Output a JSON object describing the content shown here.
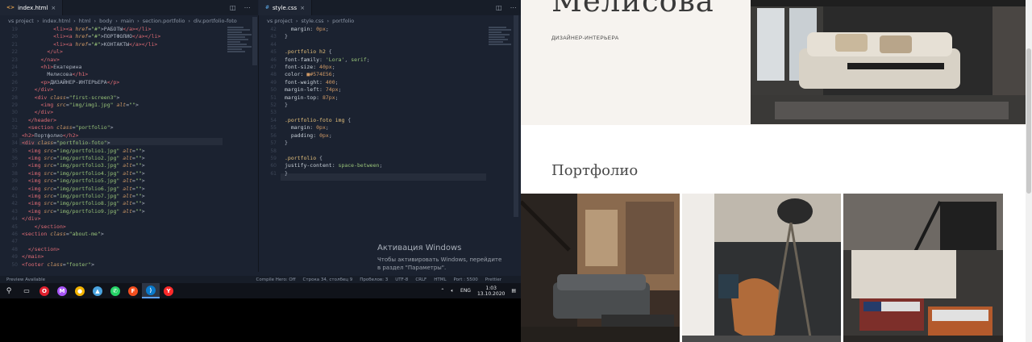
{
  "editor": {
    "left_tab": {
      "name": "index.html",
      "icon": "html-icon"
    },
    "right_tab": {
      "name": "style.css",
      "icon": "css-icon"
    },
    "left_breadcrumb": [
      "vs project",
      "index.html",
      "html",
      "body",
      "main",
      "section.portfolio",
      "div.portfolio-foto"
    ],
    "right_breadcrumb": [
      "vs project",
      "style.css",
      "portfolio"
    ],
    "html_lines": [
      {
        "indent": 10,
        "parts": [
          [
            "t",
            "<li><a "
          ],
          [
            "a",
            "href"
          ],
          [
            "p",
            "="
          ],
          [
            "s",
            "\"#\""
          ],
          [
            "p",
            ">"
          ],
          [
            "p",
            "РАБОТЫ"
          ],
          [
            "t",
            "</a></li>"
          ]
        ]
      },
      {
        "indent": 10,
        "parts": [
          [
            "t",
            "<li><a "
          ],
          [
            "a",
            "href"
          ],
          [
            "p",
            "="
          ],
          [
            "s",
            "\"#\""
          ],
          [
            "p",
            ">"
          ],
          [
            "p",
            "ПОРТФОЛИО"
          ],
          [
            "t",
            "</a></li>"
          ]
        ]
      },
      {
        "indent": 10,
        "parts": [
          [
            "t",
            "<li><a "
          ],
          [
            "a",
            "href"
          ],
          [
            "p",
            "="
          ],
          [
            "s",
            "\"#\""
          ],
          [
            "p",
            ">"
          ],
          [
            "p",
            "КОНТАКТЫ"
          ],
          [
            "t",
            "</a></li>"
          ]
        ]
      },
      {
        "indent": 8,
        "parts": [
          [
            "t",
            "</ul>"
          ]
        ]
      },
      {
        "indent": 6,
        "parts": [
          [
            "t",
            "</nav>"
          ]
        ]
      },
      {
        "indent": 6,
        "parts": [
          [
            "t",
            "<h1>"
          ],
          [
            "p",
            "Екатерина"
          ]
        ]
      },
      {
        "indent": 8,
        "parts": [
          [
            "p",
            "Мелисова"
          ],
          [
            "t",
            "</h1>"
          ]
        ]
      },
      {
        "indent": 6,
        "parts": [
          [
            "t",
            "<p>"
          ],
          [
            "p",
            "ДИЗАЙНЕР-ИНТЕРЬЕРА"
          ],
          [
            "t",
            "</p>"
          ]
        ]
      },
      {
        "indent": 4,
        "parts": [
          [
            "t",
            "</div>"
          ]
        ]
      },
      {
        "indent": 4,
        "parts": [
          [
            "t",
            "<div "
          ],
          [
            "a",
            "class"
          ],
          [
            "p",
            "="
          ],
          [
            "s",
            "\"first-screen3\""
          ],
          [
            "p",
            ">"
          ]
        ]
      },
      {
        "indent": 6,
        "parts": [
          [
            "t",
            "<img "
          ],
          [
            "a",
            "src"
          ],
          [
            "p",
            "="
          ],
          [
            "s",
            "\"img/img1.jpg\""
          ],
          [
            "a",
            " alt"
          ],
          [
            "p",
            "="
          ],
          [
            "s",
            "\"\""
          ],
          [
            "p",
            ">"
          ]
        ]
      },
      {
        "indent": 4,
        "parts": [
          [
            "t",
            "</div>"
          ]
        ]
      },
      {
        "indent": 2,
        "parts": [
          [
            "t",
            "</header>"
          ]
        ]
      },
      {
        "indent": 2,
        "parts": [
          [
            "t",
            "<section "
          ],
          [
            "a",
            "class"
          ],
          [
            "p",
            "="
          ],
          [
            "s",
            "\"portfolio\""
          ],
          [
            "p",
            ">"
          ]
        ]
      },
      {
        "indent": 0,
        "parts": [
          [
            "t",
            "<h2>"
          ],
          [
            "p",
            "Портфолио"
          ],
          [
            "t",
            "</h2>"
          ]
        ]
      },
      {
        "indent": 0,
        "parts": [
          [
            "t",
            "<div "
          ],
          [
            "a",
            "class"
          ],
          [
            "p",
            "="
          ],
          [
            "s",
            "\"portfolio-foto\""
          ],
          [
            "p",
            ">"
          ]
        ]
      },
      {
        "indent": 2,
        "parts": [
          [
            "t",
            "<img "
          ],
          [
            "a",
            "src"
          ],
          [
            "p",
            "="
          ],
          [
            "s",
            "\"img/portfolio1.jpg\""
          ],
          [
            "a",
            " alt"
          ],
          [
            "p",
            "="
          ],
          [
            "s",
            "\"\""
          ],
          [
            "p",
            ">"
          ]
        ]
      },
      {
        "indent": 2,
        "parts": [
          [
            "t",
            "<img "
          ],
          [
            "a",
            "src"
          ],
          [
            "p",
            "="
          ],
          [
            "s",
            "\"img/portfolio2.jpg\""
          ],
          [
            "a",
            " alt"
          ],
          [
            "p",
            "="
          ],
          [
            "s",
            "\"\""
          ],
          [
            "p",
            ">"
          ]
        ]
      },
      {
        "indent": 2,
        "parts": [
          [
            "t",
            "<img "
          ],
          [
            "a",
            "src"
          ],
          [
            "p",
            "="
          ],
          [
            "s",
            "\"img/portfolio3.jpg\""
          ],
          [
            "a",
            " alt"
          ],
          [
            "p",
            "="
          ],
          [
            "s",
            "\"\""
          ],
          [
            "p",
            ">"
          ]
        ]
      },
      {
        "indent": 2,
        "parts": [
          [
            "t",
            "<img "
          ],
          [
            "a",
            "src"
          ],
          [
            "p",
            "="
          ],
          [
            "s",
            "\"img/portfolio4.jpg\""
          ],
          [
            "a",
            " alt"
          ],
          [
            "p",
            "="
          ],
          [
            "s",
            "\"\""
          ],
          [
            "p",
            ">"
          ]
        ]
      },
      {
        "indent": 2,
        "parts": [
          [
            "t",
            "<img "
          ],
          [
            "a",
            "src"
          ],
          [
            "p",
            "="
          ],
          [
            "s",
            "\"img/portfolio5.jpg\""
          ],
          [
            "a",
            " alt"
          ],
          [
            "p",
            "="
          ],
          [
            "s",
            "\"\""
          ],
          [
            "p",
            ">"
          ]
        ]
      },
      {
        "indent": 2,
        "parts": [
          [
            "t",
            "<img "
          ],
          [
            "a",
            "src"
          ],
          [
            "p",
            "="
          ],
          [
            "s",
            "\"img/portfolio6.jpg\""
          ],
          [
            "a",
            " alt"
          ],
          [
            "p",
            "="
          ],
          [
            "s",
            "\"\""
          ],
          [
            "p",
            ">"
          ]
        ]
      },
      {
        "indent": 2,
        "parts": [
          [
            "t",
            "<img "
          ],
          [
            "a",
            "src"
          ],
          [
            "p",
            "="
          ],
          [
            "s",
            "\"img/portfolio7.jpg\""
          ],
          [
            "a",
            " alt"
          ],
          [
            "p",
            "="
          ],
          [
            "s",
            "\"\""
          ],
          [
            "p",
            ">"
          ]
        ]
      },
      {
        "indent": 2,
        "parts": [
          [
            "t",
            "<img "
          ],
          [
            "a",
            "src"
          ],
          [
            "p",
            "="
          ],
          [
            "s",
            "\"img/portfolio8.jpg\""
          ],
          [
            "a",
            " alt"
          ],
          [
            "p",
            "="
          ],
          [
            "s",
            "\"\""
          ],
          [
            "p",
            ">"
          ]
        ]
      },
      {
        "indent": 2,
        "parts": [
          [
            "t",
            "<img "
          ],
          [
            "a",
            "src"
          ],
          [
            "p",
            "="
          ],
          [
            "s",
            "\"img/portfolio9.jpg\""
          ],
          [
            "a",
            " alt"
          ],
          [
            "p",
            "="
          ],
          [
            "s",
            "\"\""
          ],
          [
            "p",
            ">"
          ]
        ]
      },
      {
        "indent": 0,
        "parts": [
          [
            "t",
            "</div>"
          ]
        ]
      },
      {
        "indent": 4,
        "parts": [
          [
            "t",
            "</section>"
          ]
        ]
      },
      {
        "indent": 0,
        "parts": [
          [
            "t",
            "<section "
          ],
          [
            "a",
            "class"
          ],
          [
            "p",
            "="
          ],
          [
            "s",
            "\"about-me\""
          ],
          [
            "p",
            ">"
          ]
        ]
      },
      {
        "indent": 0,
        "parts": [
          [
            "p",
            ""
          ]
        ]
      },
      {
        "indent": 2,
        "parts": [
          [
            "t",
            "</section>"
          ]
        ]
      },
      {
        "indent": 0,
        "parts": [
          [
            "t",
            "</main>"
          ]
        ]
      },
      {
        "indent": 0,
        "parts": [
          [
            "t",
            "<footer "
          ],
          [
            "a",
            "class"
          ],
          [
            "p",
            "="
          ],
          [
            "s",
            "\"footer\""
          ],
          [
            "p",
            ">"
          ]
        ]
      }
    ],
    "css_lines": [
      {
        "indent": 2,
        "parts": [
          [
            "pr",
            "margin: "
          ],
          [
            "v",
            "0px"
          ],
          [
            "p",
            ";"
          ]
        ]
      },
      {
        "indent": 0,
        "parts": [
          [
            "p",
            "}"
          ]
        ]
      },
      {
        "indent": 0,
        "parts": [
          [
            "p",
            ""
          ]
        ]
      },
      {
        "indent": 0,
        "parts": [
          [
            "sel",
            ".portfolio h2 "
          ],
          [
            "p",
            "{"
          ]
        ]
      },
      {
        "indent": 0,
        "parts": [
          [
            "pr",
            "font-family: "
          ],
          [
            "vs",
            "'Lora'"
          ],
          [
            "p",
            ", "
          ],
          [
            "vs",
            "serif"
          ],
          [
            "p",
            ";"
          ]
        ]
      },
      {
        "indent": 0,
        "parts": [
          [
            "pr",
            "font-size: "
          ],
          [
            "v",
            "40px"
          ],
          [
            "p",
            ";"
          ]
        ]
      },
      {
        "indent": 0,
        "parts": [
          [
            "pr",
            "color: "
          ],
          [
            "v",
            "■#574E56"
          ],
          [
            "p",
            ";"
          ]
        ]
      },
      {
        "indent": 0,
        "parts": [
          [
            "pr",
            "font-weight: "
          ],
          [
            "v",
            "400"
          ],
          [
            "p",
            ";"
          ]
        ]
      },
      {
        "indent": 0,
        "parts": [
          [
            "pr",
            "margin-left: "
          ],
          [
            "v",
            "74px"
          ],
          [
            "p",
            ";"
          ]
        ]
      },
      {
        "indent": 0,
        "parts": [
          [
            "pr",
            "margin-top: "
          ],
          [
            "v",
            "87px"
          ],
          [
            "p",
            ";"
          ]
        ]
      },
      {
        "indent": 0,
        "parts": [
          [
            "p",
            "}"
          ]
        ]
      },
      {
        "indent": 0,
        "parts": [
          [
            "p",
            ""
          ]
        ]
      },
      {
        "indent": 0,
        "parts": [
          [
            "sel",
            ".portfolio-foto img "
          ],
          [
            "p",
            "{"
          ]
        ]
      },
      {
        "indent": 2,
        "parts": [
          [
            "pr",
            "margin: "
          ],
          [
            "v",
            "0px"
          ],
          [
            "p",
            ";"
          ]
        ]
      },
      {
        "indent": 2,
        "parts": [
          [
            "pr",
            "padding: "
          ],
          [
            "v",
            "0px"
          ],
          [
            "p",
            ";"
          ]
        ]
      },
      {
        "indent": 0,
        "parts": [
          [
            "p",
            "}"
          ]
        ]
      },
      {
        "indent": 0,
        "parts": [
          [
            "p",
            ""
          ]
        ]
      },
      {
        "indent": 0,
        "parts": [
          [
            "sel",
            ".portfolio "
          ],
          [
            "p",
            "{"
          ]
        ]
      },
      {
        "indent": 0,
        "parts": [
          [
            "pr",
            "justify-content: "
          ],
          [
            "vs",
            "space-between"
          ],
          [
            "p",
            ";"
          ]
        ]
      },
      {
        "indent": 0,
        "parts": [
          [
            "p",
            "}"
          ]
        ]
      }
    ]
  },
  "activation": {
    "title": "Активация Windows",
    "text": "Чтобы активировать Windows, перейдите в раздел \"Параметры\"."
  },
  "statusbar": {
    "left": "Preview Available",
    "compile": "Compile Hero: Off",
    "position": "Строка 34, столбец 9",
    "spaces": "Пробелов: 3",
    "encoding": "UTF-8",
    "eol": "CRLF",
    "language": "HTML",
    "port": "Port : 5500",
    "prettier": "Prettier"
  },
  "taskbar": {
    "lang": "ENG",
    "time": "1:03",
    "date": "13.10.2020",
    "apps": [
      {
        "name": "opera-icon",
        "color": "#e0202e",
        "glyph": "O"
      },
      {
        "name": "messenger-icon",
        "color": "#a855f7",
        "glyph": "M"
      },
      {
        "name": "chrome-icon",
        "color": "#f4b400",
        "glyph": "●"
      },
      {
        "name": "photos-icon",
        "color": "#4aa3df",
        "glyph": "▲"
      },
      {
        "name": "whatsapp-icon",
        "color": "#25d366",
        "glyph": "✆"
      },
      {
        "name": "figma-icon",
        "color": "#f24e1e",
        "glyph": "F"
      },
      {
        "name": "vscode-icon",
        "color": "#0a7acc",
        "glyph": "⟩"
      },
      {
        "name": "yandex-icon",
        "color": "#ff2a2a",
        "glyph": "Y"
      }
    ]
  },
  "site": {
    "hero_name": "Мелисова",
    "hero_sub": "ДИЗАЙНЕР-ИНТЕРЬЕРА",
    "portfolio_title": "Портфолио"
  }
}
